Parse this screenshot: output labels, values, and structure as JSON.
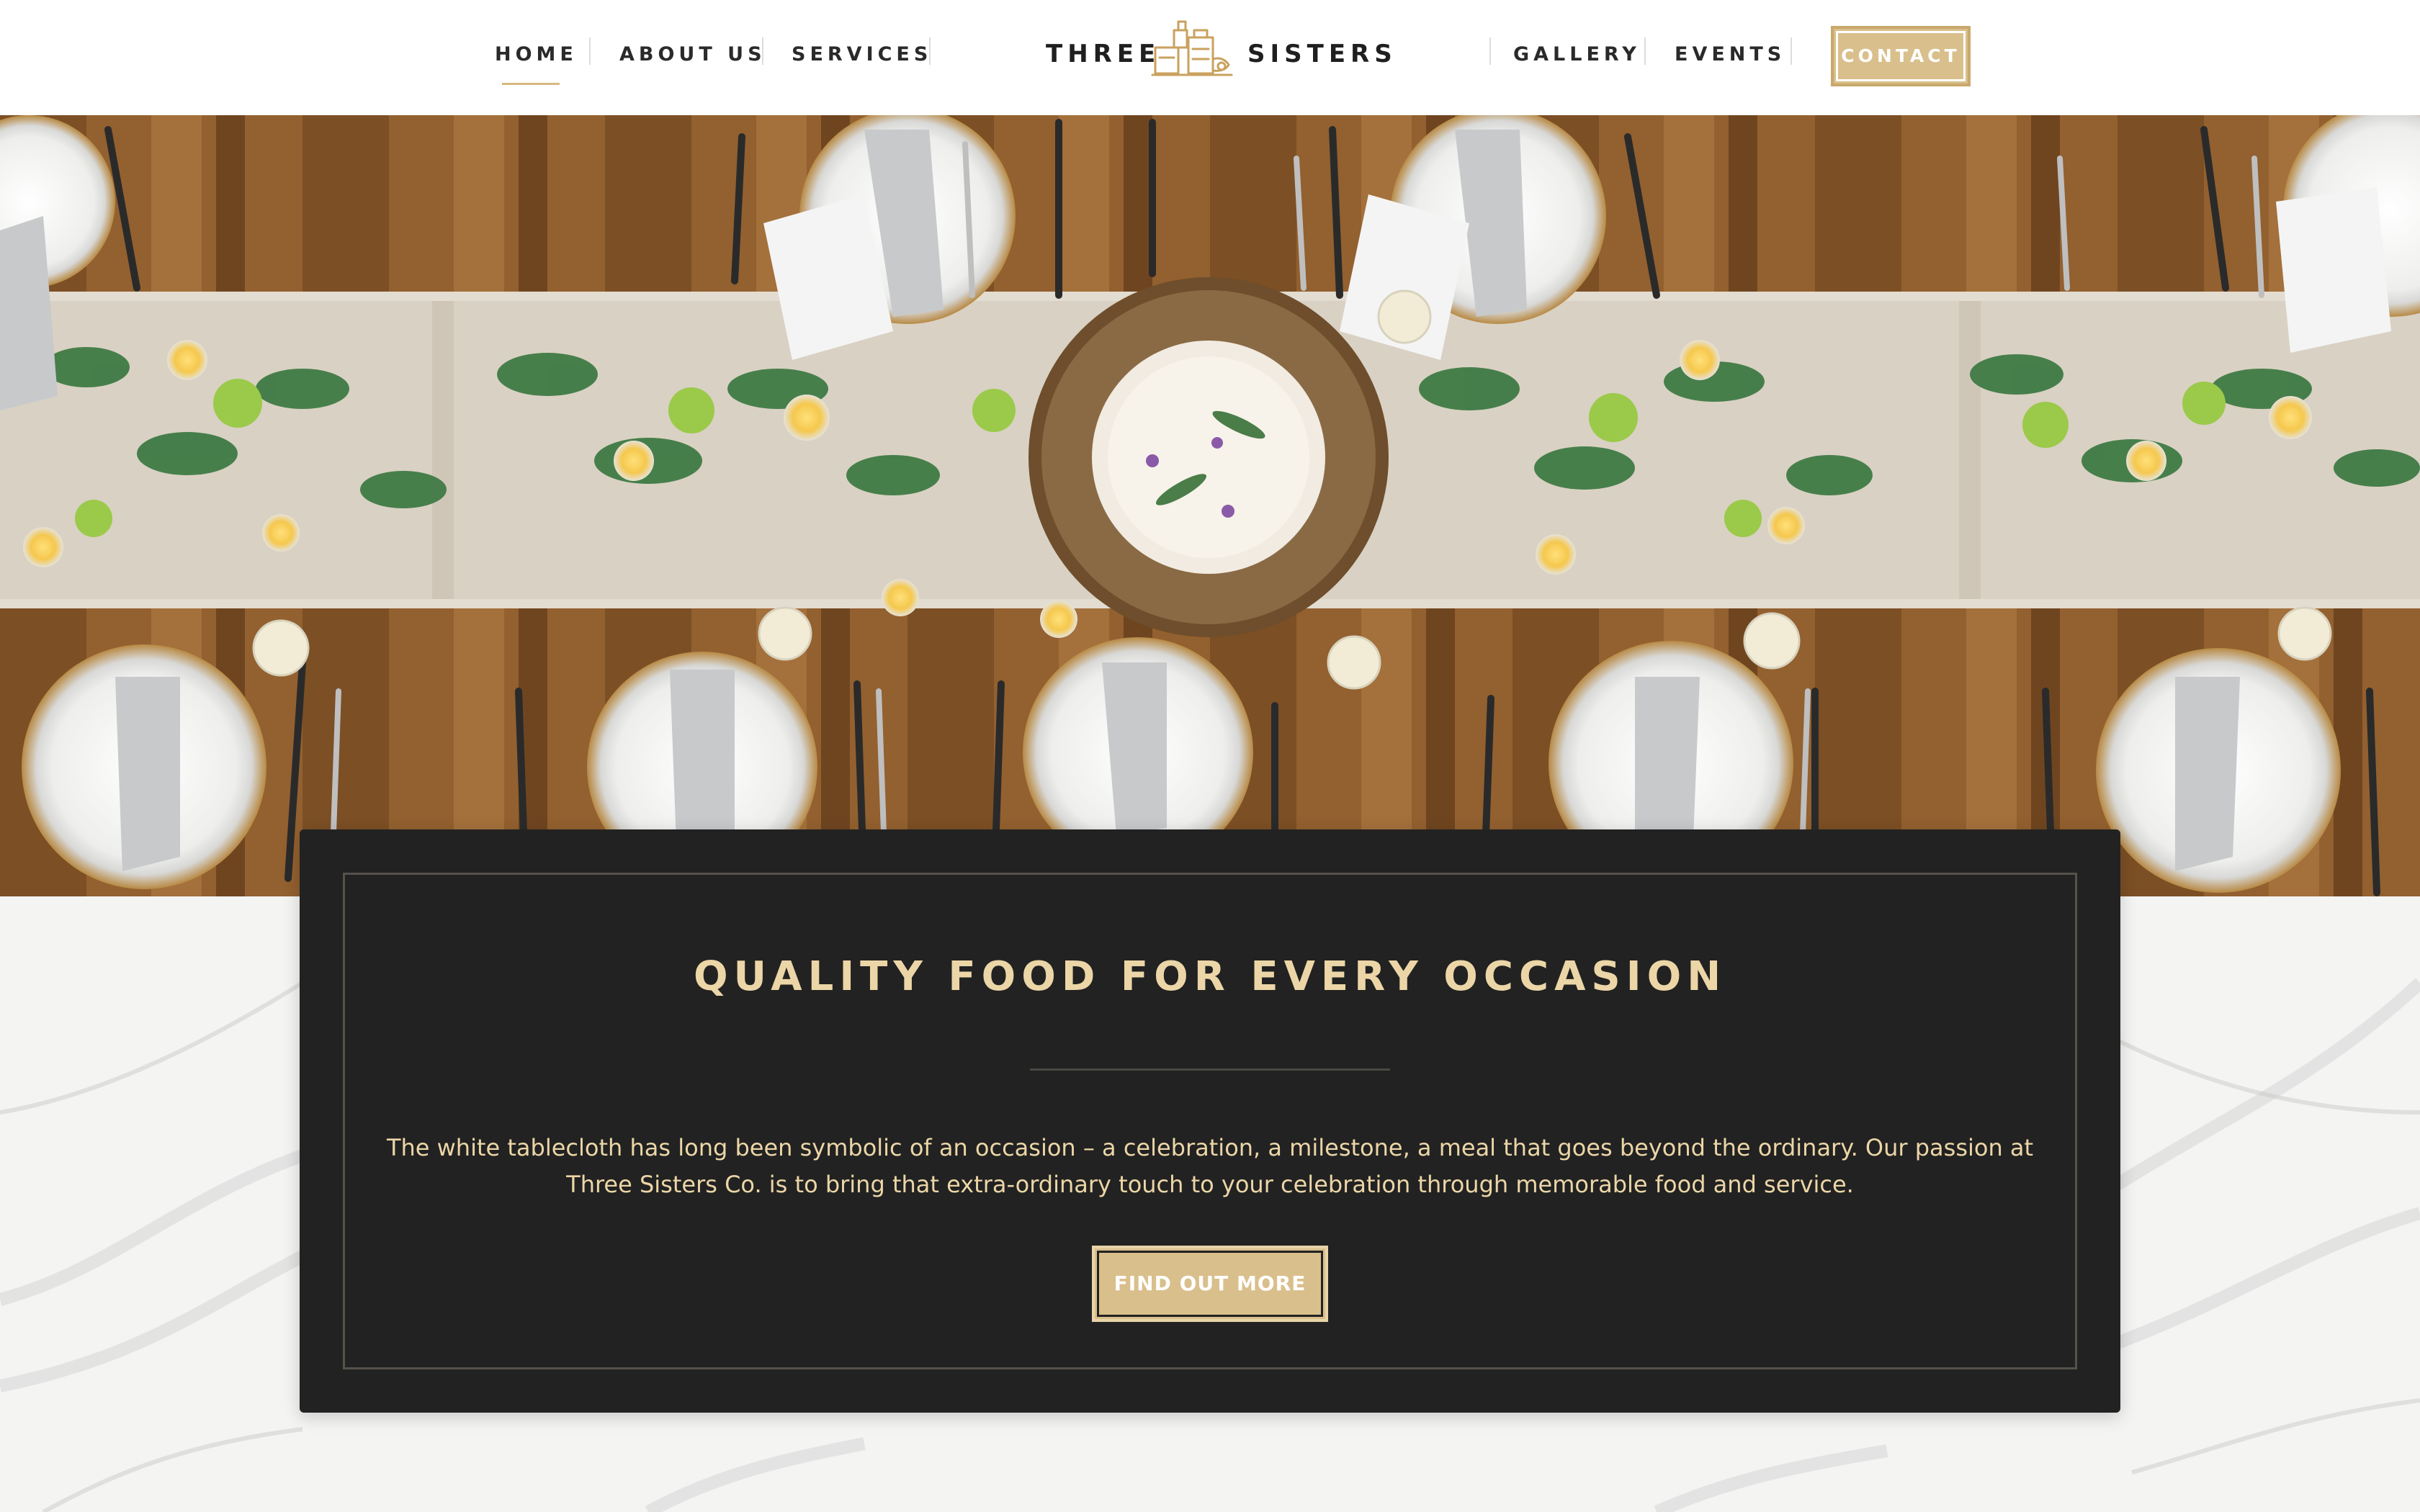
{
  "nav": {
    "left": [
      {
        "label": "HOME"
      },
      {
        "label": "ABOUT US"
      },
      {
        "label": "SERVICES"
      }
    ],
    "right": [
      {
        "label": "GALLERY"
      },
      {
        "label": "EVENTS"
      }
    ],
    "contact_label": "CONTACT"
  },
  "logo": {
    "word_left": "THREE",
    "word_right": "SISTERS",
    "icon": "cooking-icon"
  },
  "hero": {
    "image": "dining-table-setting-photo",
    "background": "marble"
  },
  "card": {
    "title": "QUALITY FOOD FOR EVERY OCCASION",
    "body": "The white tablecloth has long been symbolic of an occasion – a celebration, a milestone, a meal that goes beyond the ordinary. Our passion at Three Sisters Co. is to bring that extra-ordinary touch to your celebration through memorable food and service.",
    "cta_label": "FIND OUT MORE"
  },
  "colors": {
    "accent_gold": "#d9bf8b",
    "title_cream": "#ecd6a7",
    "card_dark": "#222222"
  }
}
